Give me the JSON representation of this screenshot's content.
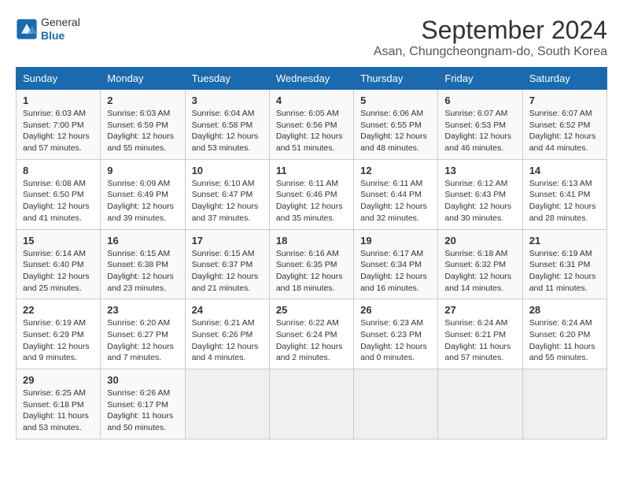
{
  "header": {
    "logo": {
      "general": "General",
      "blue": "Blue"
    },
    "title": "September 2024",
    "subtitle": "Asan, Chungcheongnam-do, South Korea"
  },
  "calendar": {
    "columns": [
      "Sunday",
      "Monday",
      "Tuesday",
      "Wednesday",
      "Thursday",
      "Friday",
      "Saturday"
    ],
    "weeks": [
      [
        null,
        null,
        null,
        null,
        null,
        null,
        null
      ]
    ],
    "days": {
      "1": {
        "day": "1",
        "sunrise": "6:03 AM",
        "sunset": "7:00 PM",
        "daylight": "12 hours and 57 minutes."
      },
      "2": {
        "day": "2",
        "sunrise": "6:03 AM",
        "sunset": "6:59 PM",
        "daylight": "12 hours and 55 minutes."
      },
      "3": {
        "day": "3",
        "sunrise": "6:04 AM",
        "sunset": "6:58 PM",
        "daylight": "12 hours and 53 minutes."
      },
      "4": {
        "day": "4",
        "sunrise": "6:05 AM",
        "sunset": "6:56 PM",
        "daylight": "12 hours and 51 minutes."
      },
      "5": {
        "day": "5",
        "sunrise": "6:06 AM",
        "sunset": "6:55 PM",
        "daylight": "12 hours and 48 minutes."
      },
      "6": {
        "day": "6",
        "sunrise": "6:07 AM",
        "sunset": "6:53 PM",
        "daylight": "12 hours and 46 minutes."
      },
      "7": {
        "day": "7",
        "sunrise": "6:07 AM",
        "sunset": "6:52 PM",
        "daylight": "12 hours and 44 minutes."
      },
      "8": {
        "day": "8",
        "sunrise": "6:08 AM",
        "sunset": "6:50 PM",
        "daylight": "12 hours and 41 minutes."
      },
      "9": {
        "day": "9",
        "sunrise": "6:09 AM",
        "sunset": "6:49 PM",
        "daylight": "12 hours and 39 minutes."
      },
      "10": {
        "day": "10",
        "sunrise": "6:10 AM",
        "sunset": "6:47 PM",
        "daylight": "12 hours and 37 minutes."
      },
      "11": {
        "day": "11",
        "sunrise": "6:11 AM",
        "sunset": "6:46 PM",
        "daylight": "12 hours and 35 minutes."
      },
      "12": {
        "day": "12",
        "sunrise": "6:11 AM",
        "sunset": "6:44 PM",
        "daylight": "12 hours and 32 minutes."
      },
      "13": {
        "day": "13",
        "sunrise": "6:12 AM",
        "sunset": "6:43 PM",
        "daylight": "12 hours and 30 minutes."
      },
      "14": {
        "day": "14",
        "sunrise": "6:13 AM",
        "sunset": "6:41 PM",
        "daylight": "12 hours and 28 minutes."
      },
      "15": {
        "day": "15",
        "sunrise": "6:14 AM",
        "sunset": "6:40 PM",
        "daylight": "12 hours and 25 minutes."
      },
      "16": {
        "day": "16",
        "sunrise": "6:15 AM",
        "sunset": "6:38 PM",
        "daylight": "12 hours and 23 minutes."
      },
      "17": {
        "day": "17",
        "sunrise": "6:15 AM",
        "sunset": "6:37 PM",
        "daylight": "12 hours and 21 minutes."
      },
      "18": {
        "day": "18",
        "sunrise": "6:16 AM",
        "sunset": "6:35 PM",
        "daylight": "12 hours and 18 minutes."
      },
      "19": {
        "day": "19",
        "sunrise": "6:17 AM",
        "sunset": "6:34 PM",
        "daylight": "12 hours and 16 minutes."
      },
      "20": {
        "day": "20",
        "sunrise": "6:18 AM",
        "sunset": "6:32 PM",
        "daylight": "12 hours and 14 minutes."
      },
      "21": {
        "day": "21",
        "sunrise": "6:19 AM",
        "sunset": "6:31 PM",
        "daylight": "12 hours and 11 minutes."
      },
      "22": {
        "day": "22",
        "sunrise": "6:19 AM",
        "sunset": "6:29 PM",
        "daylight": "12 hours and 9 minutes."
      },
      "23": {
        "day": "23",
        "sunrise": "6:20 AM",
        "sunset": "6:27 PM",
        "daylight": "12 hours and 7 minutes."
      },
      "24": {
        "day": "24",
        "sunrise": "6:21 AM",
        "sunset": "6:26 PM",
        "daylight": "12 hours and 4 minutes."
      },
      "25": {
        "day": "25",
        "sunrise": "6:22 AM",
        "sunset": "6:24 PM",
        "daylight": "12 hours and 2 minutes."
      },
      "26": {
        "day": "26",
        "sunrise": "6:23 AM",
        "sunset": "6:23 PM",
        "daylight": "12 hours and 0 minutes."
      },
      "27": {
        "day": "27",
        "sunrise": "6:24 AM",
        "sunset": "6:21 PM",
        "daylight": "11 hours and 57 minutes."
      },
      "28": {
        "day": "28",
        "sunrise": "6:24 AM",
        "sunset": "6:20 PM",
        "daylight": "11 hours and 55 minutes."
      },
      "29": {
        "day": "29",
        "sunrise": "6:25 AM",
        "sunset": "6:18 PM",
        "daylight": "11 hours and 53 minutes."
      },
      "30": {
        "day": "30",
        "sunrise": "6:26 AM",
        "sunset": "6:17 PM",
        "daylight": "11 hours and 50 minutes."
      }
    }
  }
}
